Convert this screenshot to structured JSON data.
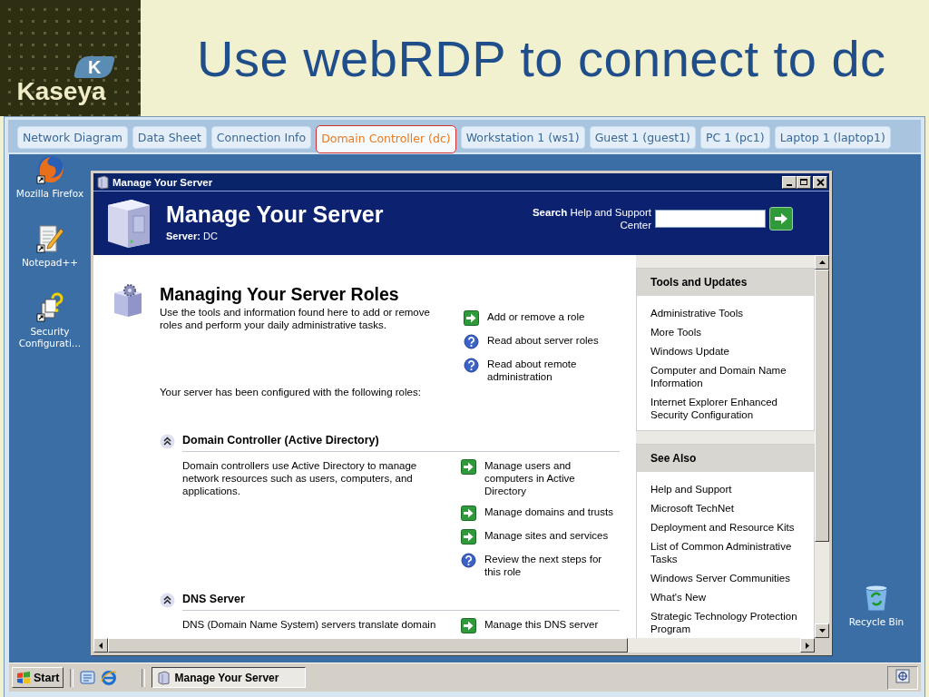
{
  "slide": {
    "title": "Use webRDP to connect to dc",
    "logo": {
      "mark": "K",
      "name": "Kaseya"
    }
  },
  "tabs": [
    {
      "label": "Network Diagram",
      "selected": false
    },
    {
      "label": "Data Sheet",
      "selected": false
    },
    {
      "label": "Connection Info",
      "selected": false
    },
    {
      "label": "Domain Controller (dc)",
      "selected": true
    },
    {
      "label": "Workstation 1 (ws1)",
      "selected": false
    },
    {
      "label": "Guest 1 (guest1)",
      "selected": false
    },
    {
      "label": "PC 1 (pc1)",
      "selected": false
    },
    {
      "label": "Laptop 1 (laptop1)",
      "selected": false
    }
  ],
  "desktop_icons": [
    {
      "kind": "firefox",
      "label": "Mozilla Firefox"
    },
    {
      "kind": "notepad",
      "label": "Notepad++"
    },
    {
      "kind": "security",
      "label": "Security Configurati…"
    }
  ],
  "recycle_bin": {
    "label": "Recycle Bin"
  },
  "window": {
    "title": "Manage Your Server",
    "header": {
      "title": "Manage Your Server",
      "server": "**Server:** DC",
      "search": "**Search** Help and Support Center"
    },
    "main": {
      "heading": "Managing Your Server Roles",
      "description": "Use the tools and information found here to add or remove roles and perform your daily administrative tasks.",
      "actions": [
        {
          "kind": "arrow",
          "label": "Add or remove a role"
        },
        {
          "kind": "help",
          "label": "Read about server roles"
        },
        {
          "kind": "help",
          "label": "Read about remote administration"
        }
      ],
      "configured_text": "Your server has been configured with the following roles:",
      "roles": [
        {
          "name": "Domain Controller (Active Directory)",
          "expanded": true,
          "description": "Domain controllers use Active Directory to manage network resources such as users, computers, and applications.",
          "actions": [
            {
              "kind": "arrow",
              "label": "Manage users and computers in Active Directory"
            },
            {
              "kind": "arrow",
              "label": "Manage domains and trusts"
            },
            {
              "kind": "arrow",
              "label": "Manage sites and services"
            },
            {
              "kind": "help",
              "label": "Review the next steps for this role"
            }
          ]
        },
        {
          "name": "DNS Server",
          "expanded": true,
          "description": "DNS (Domain Name System) servers translate domain",
          "actions": [
            {
              "kind": "arrow",
              "label": "Manage this DNS server"
            }
          ]
        }
      ]
    },
    "side_panels": [
      {
        "title": "Tools and Updates",
        "links": [
          "Administrative Tools",
          "More Tools",
          "Windows Update",
          "Computer and Domain Name Information",
          "Internet Explorer Enhanced Security Configuration"
        ]
      },
      {
        "title": "See Also",
        "links": [
          "Help and Support",
          "Microsoft TechNet",
          "Deployment and Resource Kits",
          "List of Common Administrative Tasks",
          "Windows Server Communities",
          "What's New",
          "Strategic Technology Protection Program"
        ]
      }
    ]
  },
  "taskbar": {
    "start": "Start",
    "tasks": [
      {
        "label": "Manage Your Server",
        "selected": true
      }
    ]
  }
}
